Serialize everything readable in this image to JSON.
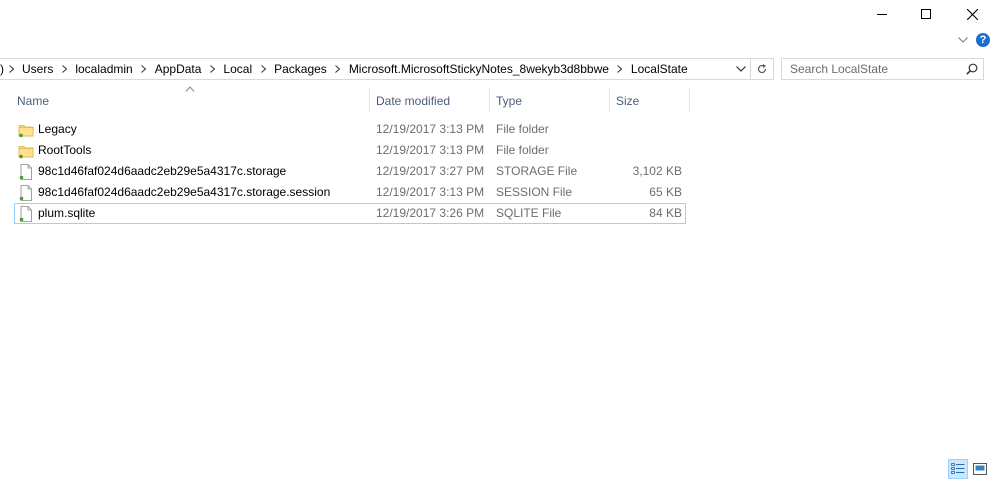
{
  "window": {
    "minimize_icon": "minimize-icon",
    "maximize_icon": "maximize-icon",
    "close_icon": "close-icon"
  },
  "ribbon": {
    "expand_icon": "chevron-down-icon",
    "help_label": "?"
  },
  "address": {
    "crumbs": [
      "Users",
      "localadmin",
      "AppData",
      "Local",
      "Packages",
      "Microsoft.MicrosoftStickyNotes_8wekyb3d8bbwe",
      "LocalState"
    ],
    "lead_glyph": ")"
  },
  "search": {
    "placeholder": "Search LocalState"
  },
  "columns": {
    "name": "Name",
    "date": "Date modified",
    "type": "Type",
    "size": "Size"
  },
  "files": [
    {
      "name": "Legacy",
      "date": "12/19/2017 3:13 PM",
      "type": "File folder",
      "size": "",
      "icon": "folder-icon"
    },
    {
      "name": "RootTools",
      "date": "12/19/2017 3:13 PM",
      "type": "File folder",
      "size": "",
      "icon": "folder-icon"
    },
    {
      "name": "98c1d46faf024d6aadc2eb29e5a4317c.storage",
      "date": "12/19/2017 3:27 PM",
      "type": "STORAGE File",
      "size": "3,102 KB",
      "icon": "file-icon"
    },
    {
      "name": "98c1d46faf024d6aadc2eb29e5a4317c.storage.session",
      "date": "12/19/2017 3:13 PM",
      "type": "SESSION File",
      "size": "65 KB",
      "icon": "file-icon"
    },
    {
      "name": "plum.sqlite",
      "date": "12/19/2017 3:26 PM",
      "type": "SQLITE File",
      "size": "84 KB",
      "icon": "file-icon"
    }
  ],
  "views": {
    "details_icon": "details-view-icon",
    "large_icons_icon": "large-icons-view-icon"
  },
  "colors": {
    "accent": "#1a6fd1",
    "header_text": "#4c607a",
    "selection_border": "#99d1ff",
    "folder_yellow": "#f8d775"
  }
}
